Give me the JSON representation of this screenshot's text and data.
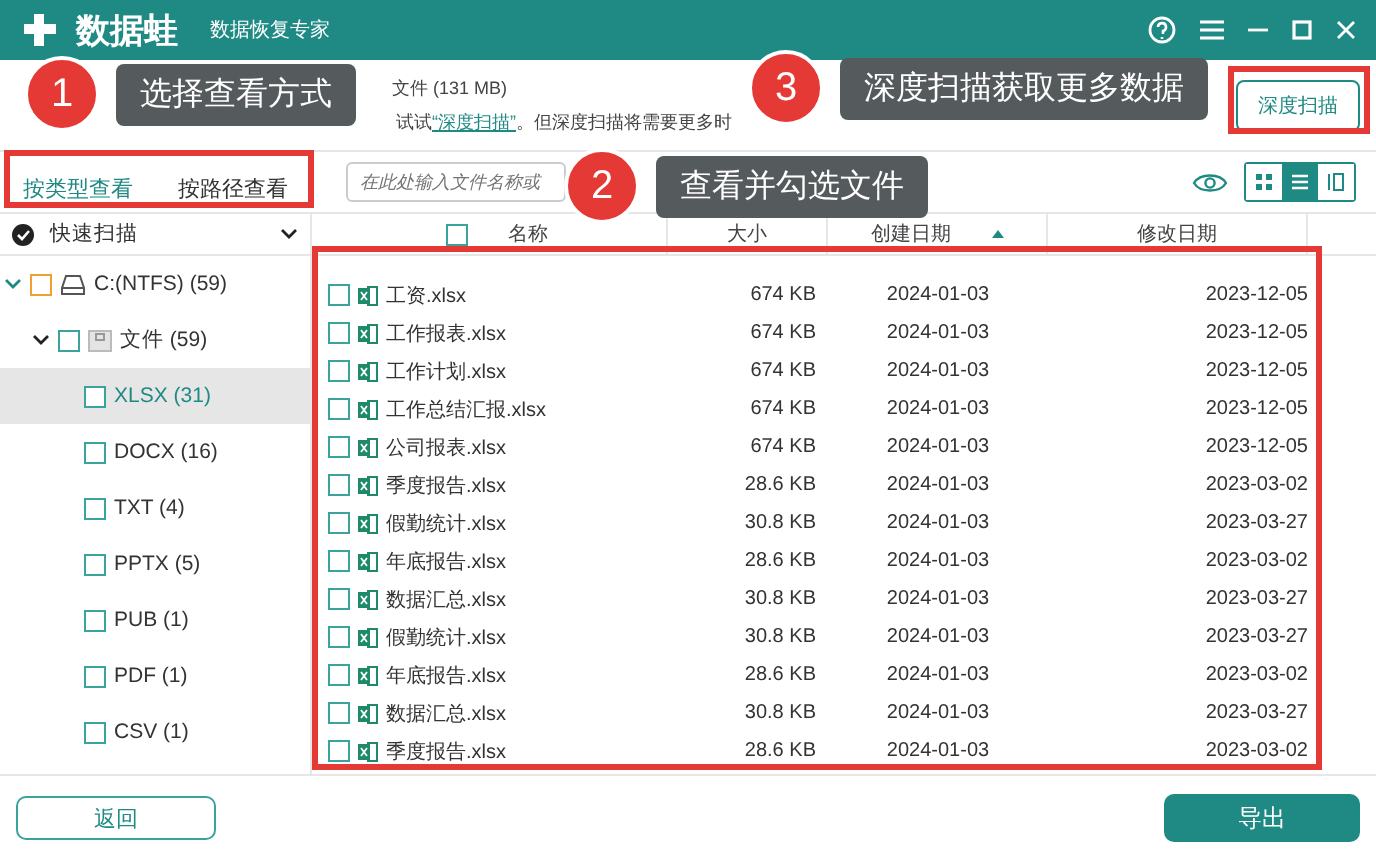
{
  "window": {
    "app_name": "数据蛙",
    "subtitle": "数据恢复专家"
  },
  "summary": {
    "found": "文件 (131 MB)",
    "hint": "试试",
    "hint_link": "“深度扫描”",
    "hint_rest": "。但深度扫描将需要更多时"
  },
  "deep_scan_button": "深度扫描",
  "view_tabs": [
    {
      "label": "按类型查看",
      "selected": true
    },
    {
      "label": "按路径查看",
      "selected": false
    }
  ],
  "search": {
    "placeholder": "在此处输入文件名称或"
  },
  "view_modes": [
    {
      "kind": "grid",
      "selected": false
    },
    {
      "kind": "list",
      "selected": true
    },
    {
      "kind": "columns",
      "selected": false
    }
  ],
  "scan_mode": "快速扫描",
  "tree": [
    {
      "label": "C:(NTFS) (59)",
      "kind": "drive",
      "expanded": true,
      "checked": false,
      "selected": false,
      "children": [
        {
          "label": "文件 (59)",
          "kind": "folder",
          "expanded": true,
          "checked": false,
          "selected": false,
          "children": [
            {
              "label": "XLSX (31)",
              "checked": false,
              "selected": true
            },
            {
              "label": "DOCX (16)",
              "checked": false,
              "selected": false
            },
            {
              "label": "TXT (4)",
              "checked": false,
              "selected": false
            },
            {
              "label": "PPTX (5)",
              "checked": false,
              "selected": false
            },
            {
              "label": "PUB (1)",
              "checked": false,
              "selected": false
            },
            {
              "label": "PDF (1)",
              "checked": false,
              "selected": false
            },
            {
              "label": "CSV (1)",
              "checked": false,
              "selected": false
            }
          ]
        }
      ]
    }
  ],
  "table": {
    "all_checked": false,
    "columns": [
      {
        "label": "名称",
        "sorted": false
      },
      {
        "label": "大小",
        "sorted": false
      },
      {
        "label": "创建日期",
        "sorted": true
      },
      {
        "label": "修改日期",
        "sorted": false
      }
    ],
    "rows": [
      {
        "name": "工资.xlsx",
        "size": "674 KB",
        "created": "2024-01-03",
        "modified": "2023-12-05",
        "checked": false
      },
      {
        "name": "工作报表.xlsx",
        "size": "674 KB",
        "created": "2024-01-03",
        "modified": "2023-12-05",
        "checked": false
      },
      {
        "name": "工作计划.xlsx",
        "size": "674 KB",
        "created": "2024-01-03",
        "modified": "2023-12-05",
        "checked": false
      },
      {
        "name": "工作总结汇报.xlsx",
        "size": "674 KB",
        "created": "2024-01-03",
        "modified": "2023-12-05",
        "checked": false
      },
      {
        "name": "公司报表.xlsx",
        "size": "674 KB",
        "created": "2024-01-03",
        "modified": "2023-12-05",
        "checked": false
      },
      {
        "name": "季度报告.xlsx",
        "size": "28.6 KB",
        "created": "2024-01-03",
        "modified": "2023-03-02",
        "checked": false
      },
      {
        "name": "假勤统计.xlsx",
        "size": "30.8 KB",
        "created": "2024-01-03",
        "modified": "2023-03-27",
        "checked": false
      },
      {
        "name": "年底报告.xlsx",
        "size": "28.6 KB",
        "created": "2024-01-03",
        "modified": "2023-03-02",
        "checked": false
      },
      {
        "name": "数据汇总.xlsx",
        "size": "30.8 KB",
        "created": "2024-01-03",
        "modified": "2023-03-27",
        "checked": false
      },
      {
        "name": "假勤统计.xlsx",
        "size": "30.8 KB",
        "created": "2024-01-03",
        "modified": "2023-03-27",
        "checked": false
      },
      {
        "name": "年底报告.xlsx",
        "size": "28.6 KB",
        "created": "2024-01-03",
        "modified": "2023-03-02",
        "checked": false
      },
      {
        "name": "数据汇总.xlsx",
        "size": "30.8 KB",
        "created": "2024-01-03",
        "modified": "2023-03-27",
        "checked": false
      },
      {
        "name": "季度报告.xlsx",
        "size": "28.6 KB",
        "created": "2024-01-03",
        "modified": "2023-03-02",
        "checked": false
      }
    ]
  },
  "buttons": {
    "back": "返回",
    "export": "导出"
  },
  "callouts": [
    {
      "number": "1",
      "text": "选择查看方式"
    },
    {
      "number": "2",
      "text": "查看并勾选文件"
    },
    {
      "number": "3",
      "text": "深度扫描获取更多数据"
    }
  ]
}
